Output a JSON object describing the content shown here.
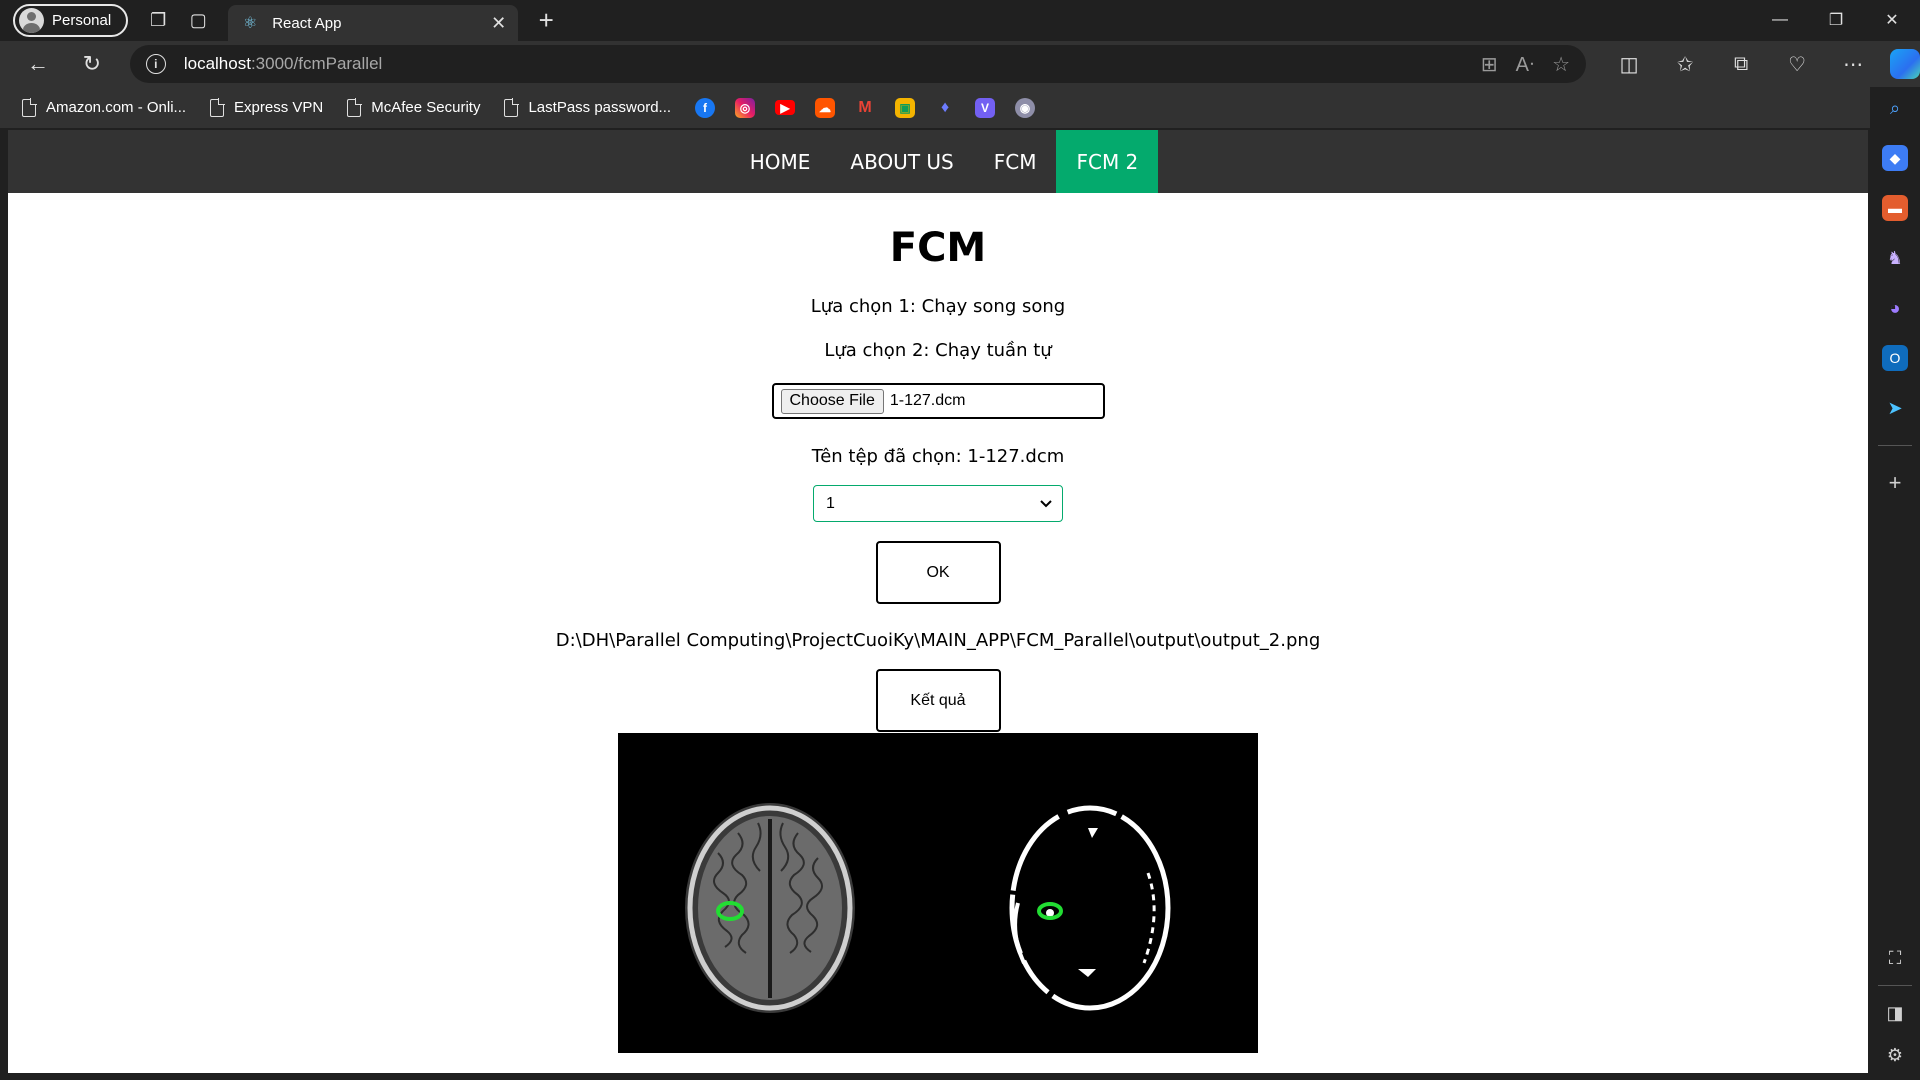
{
  "browser": {
    "profile_label": "Personal",
    "tab_title": "React App",
    "url_host": "localhost",
    "url_path": ":3000/fcmParallel"
  },
  "bookmarks": [
    "Amazon.com - Onli...",
    "Express VPN",
    "McAfee Security",
    "LastPass password..."
  ],
  "bookmark_icons": [
    "facebook-icon",
    "instagram-icon",
    "youtube-icon",
    "soundcloud-icon",
    "gmail-icon",
    "photos-icon",
    "app-icon",
    "viber-icon",
    "podcast-icon"
  ],
  "colors": {
    "nav_active": "#04aa6d",
    "nav_bg": "#333333",
    "select_border": "#04aa6d"
  },
  "app_nav": {
    "items": [
      "HOME",
      "ABOUT US",
      "FCM",
      "FCM 2"
    ],
    "active": "FCM 2"
  },
  "page": {
    "title": "FCM",
    "option_1": "Lựa chọn 1: Chạy song song",
    "option_2": "Lựa chọn 2: Chạy tuần tự",
    "choose_file_label": "Choose File",
    "file_name": "1-127.dcm",
    "selected_file_text": "Tên tệp đã chọn: 1-127.dcm",
    "select_value": "1",
    "ok_label": "OK",
    "output_path": "D:\\DH\\Parallel Computing\\ProjectCuoiKy\\MAIN_APP\\FCM_Parallel\\output\\output_2.png",
    "result_label": "Kết quả"
  }
}
